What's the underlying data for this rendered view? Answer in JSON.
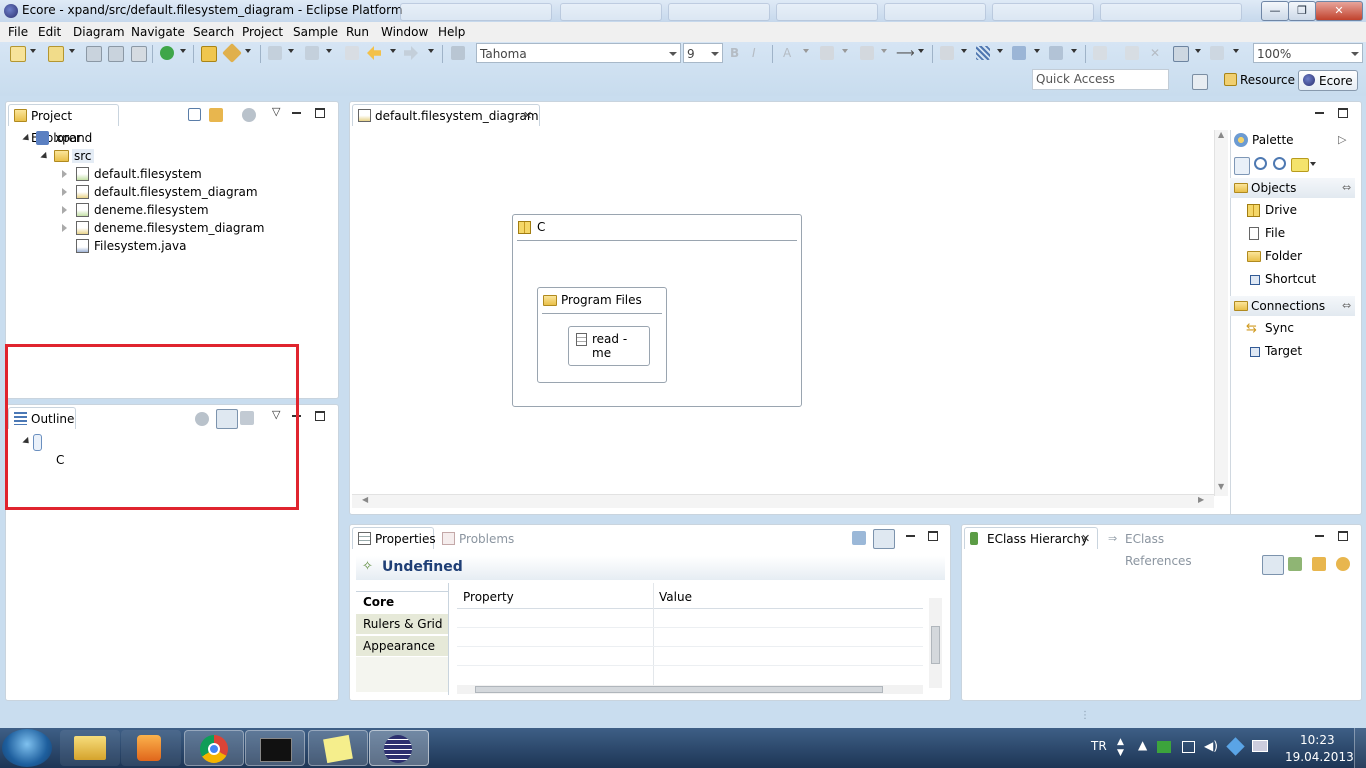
{
  "window": {
    "title": "Ecore - xpand/src/default.filesystem_diagram - Eclipse Platform",
    "minimize_label": "—",
    "maximize_label": "❐",
    "close_label": "✕"
  },
  "menu": [
    "File",
    "Edit",
    "Diagram",
    "Navigate",
    "Search",
    "Project",
    "Sample",
    "Run",
    "Window",
    "Help"
  ],
  "toolbar": {
    "font_combo": "Tahoma",
    "size_combo": "9",
    "zoom_combo": "100%",
    "quick_access_placeholder": "Quick Access",
    "perspectives": [
      "Resource",
      "Ecore"
    ]
  },
  "project_explorer": {
    "tab_label": "Project Explorer",
    "tree": {
      "project": "xpand",
      "folder": "src",
      "files": [
        "default.filesystem",
        "default.filesystem_diagram",
        "deneme.filesystem",
        "deneme.filesystem_diagram",
        "Filesystem.java"
      ]
    }
  },
  "outline": {
    "tab_label": "Outline",
    "node": "C"
  },
  "editor": {
    "tab_label": "default.filesystem_diagram",
    "drive": "C",
    "folder": "Program Files",
    "file": "read - me"
  },
  "palette": {
    "title": "Palette",
    "objects_label": "Objects",
    "objects": [
      "Drive",
      "File",
      "Folder",
      "Shortcut"
    ],
    "connections_label": "Connections",
    "connections": [
      "Sync",
      "Target"
    ]
  },
  "properties": {
    "tab_label": "Properties",
    "problems_tab_label": "Problems",
    "heading": "Undefined",
    "tabs": [
      "Core",
      "Rulers & Grid",
      "Appearance"
    ],
    "col_property": "Property",
    "col_value": "Value"
  },
  "eclass": {
    "hierarchy_tab": "EClass Hierarchy",
    "references_tab": "EClass References"
  },
  "taskbar": {
    "lang": "TR",
    "time": "10:23",
    "date": "19.04.2013"
  },
  "colors": {
    "highlight_box": "#e0242e",
    "workbench_bg": "#c9ddef",
    "taskbar": "#1d3555"
  }
}
